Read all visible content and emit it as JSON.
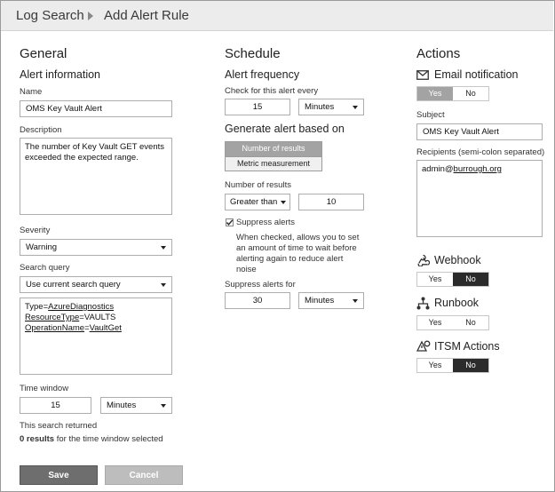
{
  "breadcrumb": {
    "root": "Log Search",
    "current": "Add Alert Rule"
  },
  "general": {
    "heading": "General",
    "alert_info_heading": "Alert information",
    "name_label": "Name",
    "name_value": "OMS Key Vault Alert",
    "description_label": "Description",
    "description_lines": [
      "The number of Key Vault GET events",
      "exceeded the expected range."
    ],
    "severity_label": "Severity",
    "severity_value": "Warning",
    "search_query_label": "Search query",
    "search_query_value": "Use current search query",
    "query_lines": [
      {
        "pre": "Type=",
        "link": "AzureDiagnostics"
      },
      {
        "pre": "",
        "link": "ResourceType",
        "post": "=VAULTS"
      },
      {
        "pre": "",
        "link": "OperationName",
        "post": "=",
        "link2": "VaultGet"
      }
    ],
    "time_window_label": "Time window",
    "time_window_value": "15",
    "time_window_unit": "Minutes",
    "search_returned": "This search returned",
    "results_count": "0 results",
    "results_suffix": " for the time window selected"
  },
  "schedule": {
    "heading": "Schedule",
    "frequency_heading": "Alert frequency",
    "check_label": "Check for this alert every",
    "check_value": "15",
    "check_unit": "Minutes",
    "generate_heading": "Generate alert based on",
    "option_results": "Number of results",
    "option_metric": "Metric measurement",
    "num_results_label": "Number of results",
    "operator_value": "Greater than",
    "threshold_value": "10",
    "suppress_label": "Suppress alerts",
    "suppress_help_lines": [
      "When checked, allows you to set",
      "an amount of time to wait before",
      "alerting again to reduce alert",
      "noise"
    ],
    "suppress_for_label": "Suppress alerts for",
    "suppress_for_value": "30",
    "suppress_for_unit": "Minutes"
  },
  "actions": {
    "heading": "Actions",
    "email_label": "Email notification",
    "email_yes": "Yes",
    "email_no": "No",
    "subject_label": "Subject",
    "subject_value": "OMS Key Vault Alert",
    "recipients_label": "Recipients (semi-colon separated)",
    "recipients_pre": "admin@",
    "recipients_link": "burrough.org",
    "webhook_label": "Webhook",
    "webhook_yes": "Yes",
    "webhook_no": "No",
    "runbook_label": "Runbook",
    "runbook_yes": "Yes",
    "runbook_no": "No",
    "itsm_label": "ITSM Actions",
    "itsm_yes": "Yes",
    "itsm_no": "No"
  },
  "footer": {
    "save_label": "Save",
    "cancel_label": "Cancel"
  }
}
